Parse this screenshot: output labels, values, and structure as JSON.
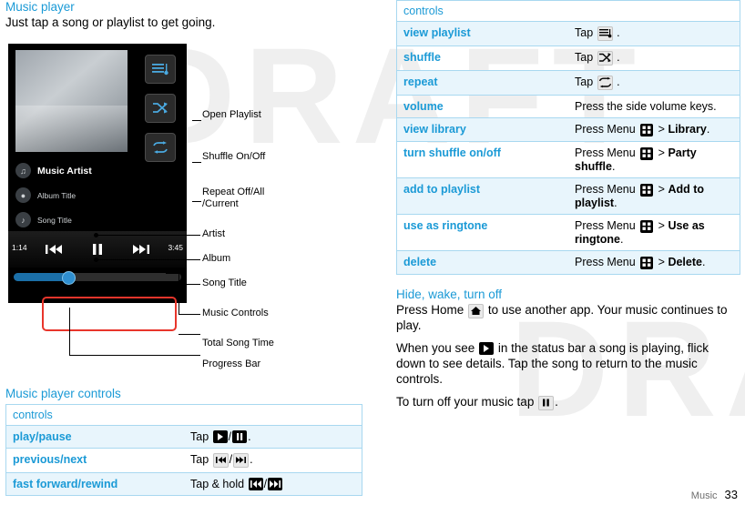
{
  "left": {
    "heading": "Music player",
    "intro": "Just tap a song or playlist to get going.",
    "illustration": {
      "callouts": [
        {
          "label": "Open Playlist"
        },
        {
          "label": "Shuffle On/Off"
        },
        {
          "label": "Repeat Off/All\n/Current"
        },
        {
          "label": "Artist"
        },
        {
          "label": "Album"
        },
        {
          "label": "Song Title"
        },
        {
          "label": "Music Controls"
        },
        {
          "label": "Total Song Time"
        },
        {
          "label": "Progress Bar"
        }
      ],
      "phone": {
        "artist": "Music Artist",
        "album": "Album Title",
        "song": "Song Title",
        "elapsed": "1:14",
        "total": "3:45"
      }
    },
    "controls_heading": "Music player controls",
    "table": {
      "header": "controls",
      "rows": [
        {
          "key": "play/pause",
          "value_prefix": "Tap",
          "value_icons": "play/pause",
          "value_suffix": "."
        },
        {
          "key": "previous/next",
          "value_prefix": "Tap",
          "value_icons": "previous/next",
          "value_suffix": "."
        },
        {
          "key": "fast forward/rewind",
          "value_prefix": "Tap & hold",
          "value_icons": "rewind/forward",
          "value_suffix": ""
        }
      ]
    }
  },
  "right": {
    "table": {
      "header": "controls",
      "rows": [
        {
          "key": "view playlist",
          "text": "Tap",
          "icon": "playlist-icon",
          "tail": "."
        },
        {
          "key": "shuffle",
          "text": "Tap",
          "icon": "shuffle-icon",
          "tail": "."
        },
        {
          "key": "repeat",
          "text": "Tap",
          "icon": "repeat-icon",
          "tail": "."
        },
        {
          "key": "volume",
          "text": "Press the side volume keys.",
          "icon": "",
          "tail": ""
        },
        {
          "key": "view library",
          "text": "Press Menu",
          "icon": "menu-icon",
          "tail": "> ",
          "bold": "Library",
          "tail2": "."
        },
        {
          "key": "turn shuffle on/off",
          "text": "Press Menu",
          "icon": "menu-icon",
          "tail": "> ",
          "bold": "Party shuffle",
          "tail2": "."
        },
        {
          "key": "add to playlist",
          "text": "Press Menu",
          "icon": "menu-icon",
          "tail": "> ",
          "bold": "Add to playlist",
          "tail2": "."
        },
        {
          "key": "use as ringtone",
          "text": "Press Menu",
          "icon": "menu-icon",
          "tail": "> ",
          "bold": "Use as ringtone",
          "tail2": "."
        },
        {
          "key": "delete",
          "text": "Press Menu",
          "icon": "menu-icon",
          "tail": "> ",
          "bold": "Delete",
          "tail2": "."
        }
      ]
    },
    "hide_heading": "Hide, wake, turn off",
    "para1_a": "Press Home",
    "para1_b": "to use another app. Your music continues to play.",
    "para2_a": "When you see",
    "para2_b": "in the status bar a song is playing, flick down to see details. Tap the song to return to the music controls.",
    "para3_a": "To turn off your music tap",
    "para3_b": "."
  },
  "footer": {
    "label": "Music",
    "page": "33"
  },
  "watermark": "DRAFT",
  "colors": {
    "accent": "#1b9ad6",
    "table_alt": "#e8f5fc",
    "table_border": "#a8d8f0",
    "highlight": "#e8352b"
  }
}
